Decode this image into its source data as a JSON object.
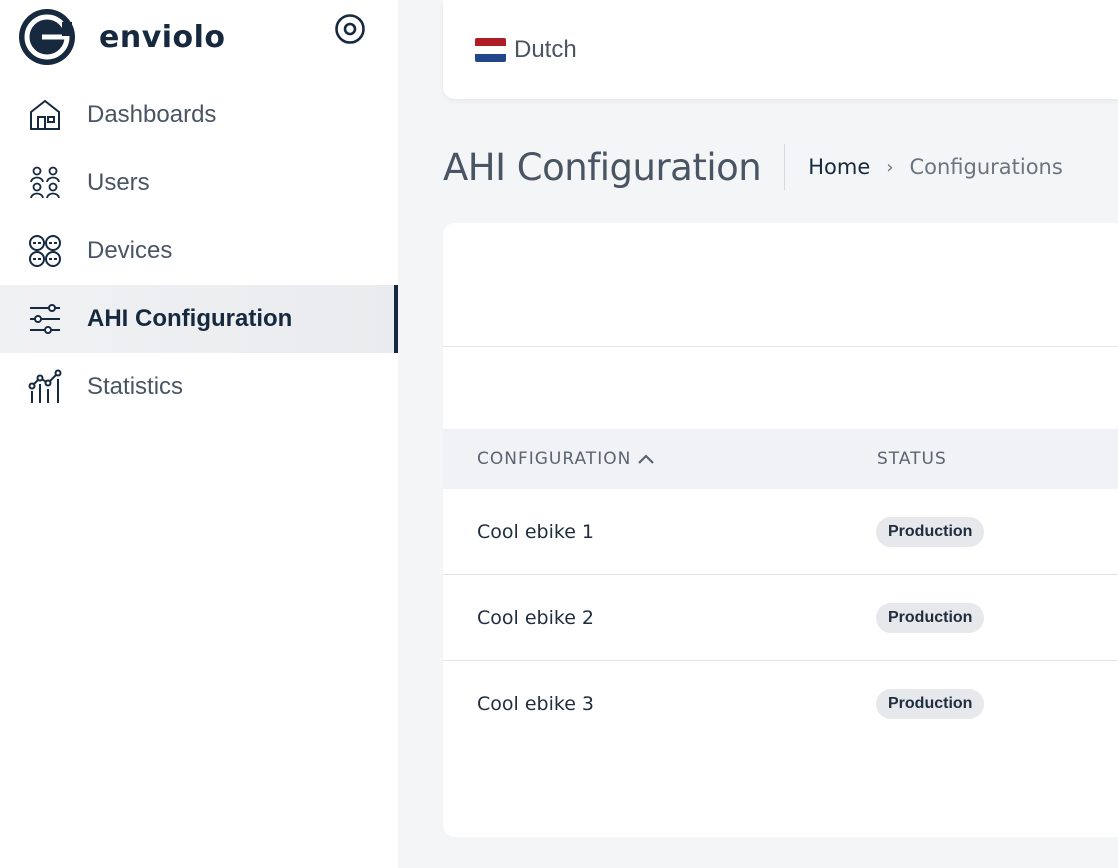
{
  "brand": {
    "name": "enviolo"
  },
  "sidebar": {
    "items": [
      {
        "label": "Dashboards",
        "icon": "home-icon",
        "active": false
      },
      {
        "label": "Users",
        "icon": "users-icon",
        "active": false
      },
      {
        "label": "Devices",
        "icon": "devices-icon",
        "active": false
      },
      {
        "label": "AHI Configuration",
        "icon": "sliders-icon",
        "active": true
      },
      {
        "label": "Statistics",
        "icon": "statistics-icon",
        "active": false
      }
    ]
  },
  "topbar": {
    "language": {
      "label": "Dutch",
      "flag_colors": [
        "#ae1c28",
        "#ffffff",
        "#21468b"
      ]
    }
  },
  "page": {
    "title": "AHI Configuration",
    "breadcrumb": {
      "home": "Home",
      "current": "Configurations"
    }
  },
  "table": {
    "columns": {
      "configuration": "CONFIGURATION",
      "status": "STATUS"
    },
    "rows": [
      {
        "name": "Cool ebike 1",
        "status": "Production"
      },
      {
        "name": "Cool ebike 2",
        "status": "Production"
      },
      {
        "name": "Cool ebike 3",
        "status": "Production"
      }
    ]
  },
  "colors": {
    "brand": "#16293f",
    "accent_bg": "#e9ebee",
    "page_bg": "#f4f5f7"
  }
}
